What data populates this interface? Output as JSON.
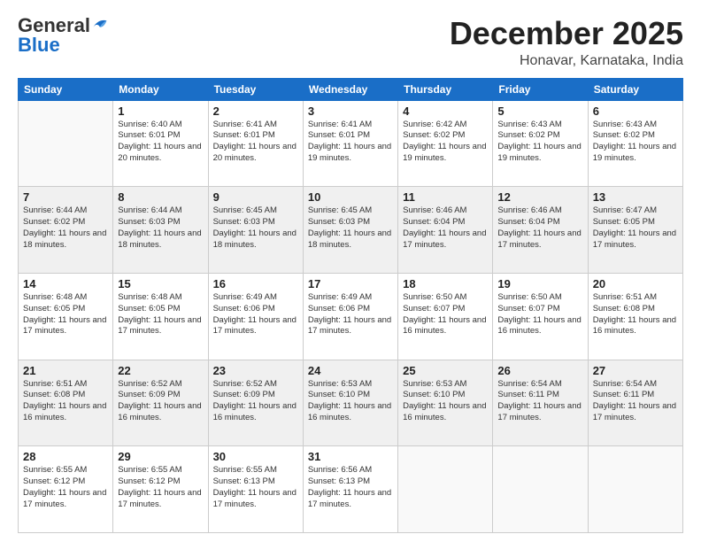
{
  "header": {
    "logo_general": "General",
    "logo_blue": "Blue",
    "month_title": "December 2025",
    "location": "Honavar, Karnataka, India"
  },
  "days_of_week": [
    "Sunday",
    "Monday",
    "Tuesday",
    "Wednesday",
    "Thursday",
    "Friday",
    "Saturday"
  ],
  "weeks": [
    [
      {
        "day": "",
        "empty": true
      },
      {
        "day": "1",
        "sunrise": "6:40 AM",
        "sunset": "6:01 PM",
        "daylight": "11 hours and 20 minutes."
      },
      {
        "day": "2",
        "sunrise": "6:41 AM",
        "sunset": "6:01 PM",
        "daylight": "11 hours and 20 minutes."
      },
      {
        "day": "3",
        "sunrise": "6:41 AM",
        "sunset": "6:01 PM",
        "daylight": "11 hours and 19 minutes."
      },
      {
        "day": "4",
        "sunrise": "6:42 AM",
        "sunset": "6:02 PM",
        "daylight": "11 hours and 19 minutes."
      },
      {
        "day": "5",
        "sunrise": "6:43 AM",
        "sunset": "6:02 PM",
        "daylight": "11 hours and 19 minutes."
      },
      {
        "day": "6",
        "sunrise": "6:43 AM",
        "sunset": "6:02 PM",
        "daylight": "11 hours and 19 minutes."
      }
    ],
    [
      {
        "day": "7",
        "sunrise": "6:44 AM",
        "sunset": "6:02 PM",
        "daylight": "11 hours and 18 minutes."
      },
      {
        "day": "8",
        "sunrise": "6:44 AM",
        "sunset": "6:03 PM",
        "daylight": "11 hours and 18 minutes."
      },
      {
        "day": "9",
        "sunrise": "6:45 AM",
        "sunset": "6:03 PM",
        "daylight": "11 hours and 18 minutes."
      },
      {
        "day": "10",
        "sunrise": "6:45 AM",
        "sunset": "6:03 PM",
        "daylight": "11 hours and 18 minutes."
      },
      {
        "day": "11",
        "sunrise": "6:46 AM",
        "sunset": "6:04 PM",
        "daylight": "11 hours and 17 minutes."
      },
      {
        "day": "12",
        "sunrise": "6:46 AM",
        "sunset": "6:04 PM",
        "daylight": "11 hours and 17 minutes."
      },
      {
        "day": "13",
        "sunrise": "6:47 AM",
        "sunset": "6:05 PM",
        "daylight": "11 hours and 17 minutes."
      }
    ],
    [
      {
        "day": "14",
        "sunrise": "6:48 AM",
        "sunset": "6:05 PM",
        "daylight": "11 hours and 17 minutes."
      },
      {
        "day": "15",
        "sunrise": "6:48 AM",
        "sunset": "6:05 PM",
        "daylight": "11 hours and 17 minutes."
      },
      {
        "day": "16",
        "sunrise": "6:49 AM",
        "sunset": "6:06 PM",
        "daylight": "11 hours and 17 minutes."
      },
      {
        "day": "17",
        "sunrise": "6:49 AM",
        "sunset": "6:06 PM",
        "daylight": "11 hours and 17 minutes."
      },
      {
        "day": "18",
        "sunrise": "6:50 AM",
        "sunset": "6:07 PM",
        "daylight": "11 hours and 16 minutes."
      },
      {
        "day": "19",
        "sunrise": "6:50 AM",
        "sunset": "6:07 PM",
        "daylight": "11 hours and 16 minutes."
      },
      {
        "day": "20",
        "sunrise": "6:51 AM",
        "sunset": "6:08 PM",
        "daylight": "11 hours and 16 minutes."
      }
    ],
    [
      {
        "day": "21",
        "sunrise": "6:51 AM",
        "sunset": "6:08 PM",
        "daylight": "11 hours and 16 minutes."
      },
      {
        "day": "22",
        "sunrise": "6:52 AM",
        "sunset": "6:09 PM",
        "daylight": "11 hours and 16 minutes."
      },
      {
        "day": "23",
        "sunrise": "6:52 AM",
        "sunset": "6:09 PM",
        "daylight": "11 hours and 16 minutes."
      },
      {
        "day": "24",
        "sunrise": "6:53 AM",
        "sunset": "6:10 PM",
        "daylight": "11 hours and 16 minutes."
      },
      {
        "day": "25",
        "sunrise": "6:53 AM",
        "sunset": "6:10 PM",
        "daylight": "11 hours and 16 minutes."
      },
      {
        "day": "26",
        "sunrise": "6:54 AM",
        "sunset": "6:11 PM",
        "daylight": "11 hours and 17 minutes."
      },
      {
        "day": "27",
        "sunrise": "6:54 AM",
        "sunset": "6:11 PM",
        "daylight": "11 hours and 17 minutes."
      }
    ],
    [
      {
        "day": "28",
        "sunrise": "6:55 AM",
        "sunset": "6:12 PM",
        "daylight": "11 hours and 17 minutes."
      },
      {
        "day": "29",
        "sunrise": "6:55 AM",
        "sunset": "6:12 PM",
        "daylight": "11 hours and 17 minutes."
      },
      {
        "day": "30",
        "sunrise": "6:55 AM",
        "sunset": "6:13 PM",
        "daylight": "11 hours and 17 minutes."
      },
      {
        "day": "31",
        "sunrise": "6:56 AM",
        "sunset": "6:13 PM",
        "daylight": "11 hours and 17 minutes."
      },
      {
        "day": "",
        "empty": true
      },
      {
        "day": "",
        "empty": true
      },
      {
        "day": "",
        "empty": true
      }
    ]
  ]
}
